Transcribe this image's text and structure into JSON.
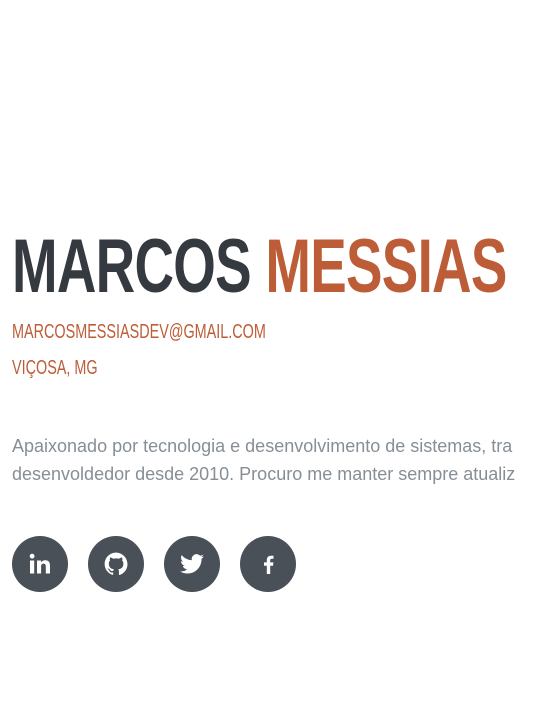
{
  "profile": {
    "first_name": "MARCOS",
    "last_name": "MESSIAS",
    "email": "MARCOSMESSIASDEV@GMAIL.COM",
    "city": "VIÇOSA, MG",
    "bio_line1": "Apaixonado por tecnologia e desenvolvimento de sistemas, tra",
    "bio_line2": "desenvoldedor desde 2010. Procuro me manter sempre atualiz"
  },
  "social": [
    {
      "name": "linkedin",
      "icon": "linkedin-icon"
    },
    {
      "name": "github",
      "icon": "github-icon"
    },
    {
      "name": "twitter",
      "icon": "twitter-icon"
    },
    {
      "name": "facebook",
      "icon": "facebook-icon"
    }
  ],
  "colors": {
    "primary": "#bd5d38",
    "heading": "#343a40",
    "text": "#868e96",
    "social_bg": "#495057"
  }
}
